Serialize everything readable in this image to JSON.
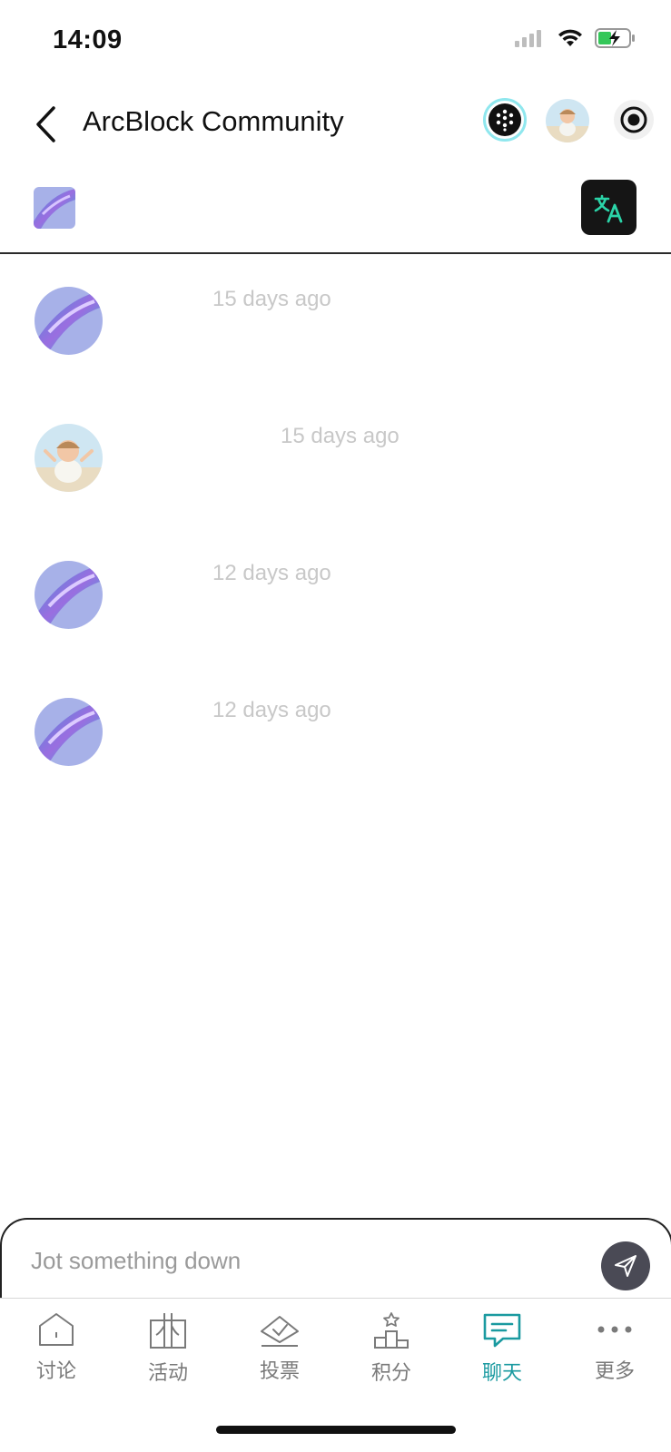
{
  "status_bar": {
    "time": "14:09"
  },
  "header": {
    "title": "ArcBlock Community"
  },
  "messages": [
    {
      "time": "15 days ago",
      "sender": "community"
    },
    {
      "time": "15 days ago",
      "sender": "user"
    },
    {
      "time": "12 days ago",
      "sender": "community"
    },
    {
      "time": "12 days ago",
      "sender": "community"
    }
  ],
  "composer": {
    "placeholder": "Jot something down"
  },
  "tabs": [
    {
      "label": "讨论",
      "icon": "home-icon"
    },
    {
      "label": "活动",
      "icon": "gift-icon"
    },
    {
      "label": "投票",
      "icon": "vote-icon"
    },
    {
      "label": "积分",
      "icon": "podium-icon"
    },
    {
      "label": "聊天",
      "icon": "chat-icon",
      "active": true
    },
    {
      "label": "更多",
      "icon": "more-icon"
    }
  ],
  "colors": {
    "accent": "#1a9aa0",
    "translate_icon": "#2bd4a8"
  }
}
